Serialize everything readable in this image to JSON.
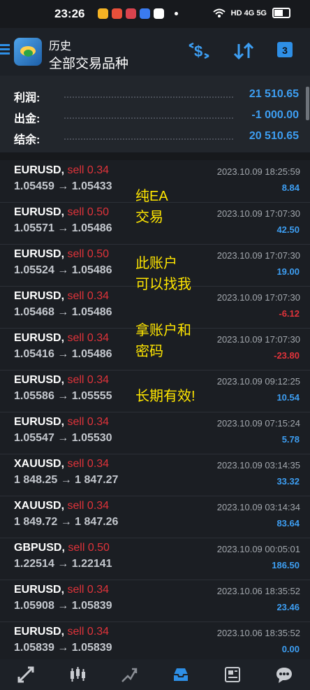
{
  "status_bar": {
    "time": "23:26",
    "network": "HD 4G 5G"
  },
  "header": {
    "subtitle": "历史",
    "title": "全部交易品种",
    "icons": [
      "menu-icon",
      "app-logo",
      "currency-filter-icon",
      "sort-icon",
      "calendar-icon"
    ],
    "calendar_day": "3"
  },
  "summary": [
    {
      "label": "利润:",
      "value": "21 510.65"
    },
    {
      "label": "出金:",
      "value": "-1 000.00"
    },
    {
      "label": "结余:",
      "value": "20 510.65"
    }
  ],
  "deals": [
    {
      "symbol": "EURUSD,",
      "type": "sell 0.34",
      "prices": "1.05459 → 1.05433",
      "time": "2023.10.09 18:25:59",
      "profit": "8.84"
    },
    {
      "symbol": "EURUSD,",
      "type": "sell 0.50",
      "prices": "1.05571 → 1.05486",
      "time": "2023.10.09 17:07:30",
      "profit": "42.50"
    },
    {
      "symbol": "EURUSD,",
      "type": "sell 0.50",
      "prices": "1.05524 → 1.05486",
      "time": "2023.10.09 17:07:30",
      "profit": "19.00"
    },
    {
      "symbol": "EURUSD,",
      "type": "sell 0.34",
      "prices": "1.05468 → 1.05486",
      "time": "2023.10.09 17:07:30",
      "profit": "-6.12"
    },
    {
      "symbol": "EURUSD,",
      "type": "sell 0.34",
      "prices": "1.05416 → 1.05486",
      "time": "2023.10.09 17:07:30",
      "profit": "-23.80"
    },
    {
      "symbol": "EURUSD,",
      "type": "sell 0.34",
      "prices": "1.05586 → 1.05555",
      "time": "2023.10.09 09:12:25",
      "profit": "10.54"
    },
    {
      "symbol": "EURUSD,",
      "type": "sell 0.34",
      "prices": "1.05547 → 1.05530",
      "time": "2023.10.09 07:15:24",
      "profit": "5.78"
    },
    {
      "symbol": "XAUUSD,",
      "type": "sell 0.34",
      "prices": "1 848.25 → 1 847.27",
      "time": "2023.10.09 03:14:35",
      "profit": "33.32"
    },
    {
      "symbol": "XAUUSD,",
      "type": "sell 0.34",
      "prices": "1 849.72 → 1 847.26",
      "time": "2023.10.09 03:14:34",
      "profit": "83.64"
    },
    {
      "symbol": "GBPUSD,",
      "type": "sell 0.50",
      "prices": "1.22514 → 1.22141",
      "time": "2023.10.09 00:05:01",
      "profit": "186.50"
    },
    {
      "symbol": "EURUSD,",
      "type": "sell 0.34",
      "prices": "1.05908 → 1.05839",
      "time": "2023.10.06 18:35:52",
      "profit": "23.46"
    },
    {
      "symbol": "EURUSD,",
      "type": "sell 0.34",
      "prices": "1.05839 → 1.05839",
      "time": "2023.10.06 18:35:52",
      "profit": "0.00"
    }
  ],
  "overlay_text": {
    "line1": "纯EA",
    "line2": "交易",
    "line3": "此账户",
    "line4": "可以找我",
    "line5": "拿账户和",
    "line6": "密码",
    "line7": "长期有效!"
  },
  "bottom_nav": [
    "quotes-icon",
    "chart-icon",
    "trade-icon",
    "history-icon",
    "news-icon",
    "chat-icon"
  ],
  "colors": {
    "accent": "#3d9ef2",
    "sell": "#e0333a",
    "overlay": "#ffe600",
    "background": "#1b1e23"
  }
}
